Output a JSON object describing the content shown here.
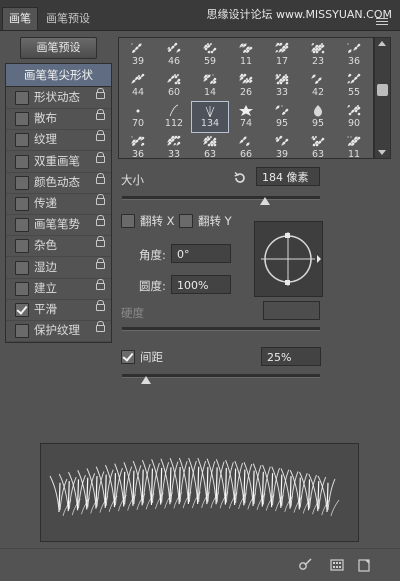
{
  "tabs": [
    {
      "label": "画笔",
      "active": true
    },
    {
      "label": "画笔预设",
      "active": false
    }
  ],
  "watermark": "思缘设计论坛 www.MISSYUAN.COM",
  "preset_button": "画笔预设",
  "brush_tip_header": "画笔笔尖形状",
  "options": [
    {
      "label": "形状动态",
      "checked": false
    },
    {
      "label": "散布",
      "checked": false
    },
    {
      "label": "纹理",
      "checked": false
    },
    {
      "label": "双重画笔",
      "checked": false
    },
    {
      "label": "颜色动态",
      "checked": false
    },
    {
      "label": "传递",
      "checked": false
    },
    {
      "label": "画笔笔势",
      "checked": false
    },
    {
      "label": "杂色",
      "checked": false
    },
    {
      "label": "湿边",
      "checked": false
    },
    {
      "label": "建立",
      "checked": false
    },
    {
      "label": "平滑",
      "checked": true
    },
    {
      "label": "保护纹理",
      "checked": false
    }
  ],
  "brush_sizes": [
    [
      "39",
      "46",
      "59",
      "11",
      "17",
      "23",
      "36"
    ],
    [
      "44",
      "60",
      "14",
      "26",
      "33",
      "42",
      "55"
    ],
    [
      "70",
      "112",
      "134",
      "74",
      "95",
      "95",
      "90"
    ],
    [
      "36",
      "33",
      "63",
      "66",
      "39",
      "63",
      "11"
    ]
  ],
  "selected_brush": "134",
  "size": {
    "label": "大小",
    "value": "184 像素"
  },
  "flip_x": {
    "label": "翻转 X",
    "checked": false
  },
  "flip_y": {
    "label": "翻转 Y",
    "checked": false
  },
  "angle": {
    "label": "角度:",
    "value": "0°"
  },
  "roundness": {
    "label": "圆度:",
    "value": "100%"
  },
  "hardness": {
    "label": "硬度",
    "value": ""
  },
  "spacing": {
    "label": "间距",
    "value": "25%",
    "checked": true
  },
  "sliders": {
    "size_level": 0.72,
    "spacing_level": 0.12
  },
  "colors": {
    "panel": "#535353",
    "selected": "#5f6c82",
    "dark": "#3a3a3a"
  }
}
